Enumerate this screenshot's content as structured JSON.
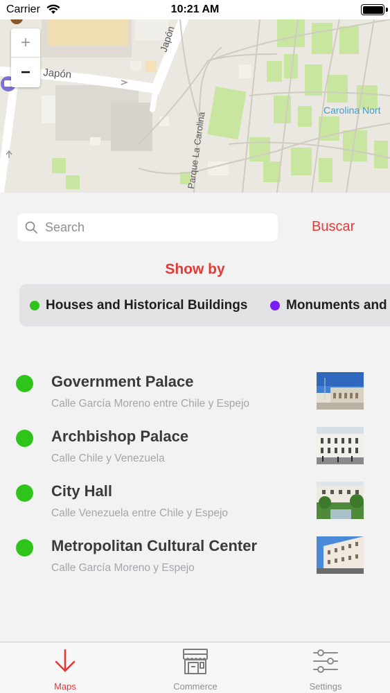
{
  "status_bar": {
    "carrier": "Carrier",
    "time": "10:21 AM"
  },
  "map": {
    "zoom_in": "+",
    "zoom_out": "−",
    "labels": {
      "street_japon_horizontal": "Japón",
      "street_japon_vertical": "Japón",
      "street_parque_la_carolina": "Parque La Carolina",
      "area_carolina_norte": "Carolina Nort"
    }
  },
  "search": {
    "placeholder": "Search",
    "value": "",
    "button_label": "Buscar"
  },
  "filter": {
    "heading": "Show by",
    "options": [
      {
        "label": "Houses and Historical Buildings",
        "color": "#2ec41a"
      },
      {
        "label": "Monuments and",
        "color": "#7a1cf5"
      }
    ]
  },
  "places": [
    {
      "title": "Government Palace",
      "address": "Calle García Moreno entre Chile y Espejo"
    },
    {
      "title": "Archbishop Palace",
      "address": "Calle Chile y Venezuela"
    },
    {
      "title": "City Hall",
      "address": "Calle Venezuela entre Chile y Espejo"
    },
    {
      "title": "Metropolitan Cultural Center",
      "address": "Calle García Moreno y Espejo"
    }
  ],
  "tabs": [
    {
      "label": "Maps",
      "icon": "arrow-down-icon",
      "active": true
    },
    {
      "label": "Commerce",
      "icon": "storefront-icon",
      "active": false
    },
    {
      "label": "Settings",
      "icon": "sliders-icon",
      "active": false
    }
  ],
  "colors": {
    "accent": "#e53935",
    "place_dot": "#2ec41a",
    "tab_inactive": "#8e8e93"
  }
}
